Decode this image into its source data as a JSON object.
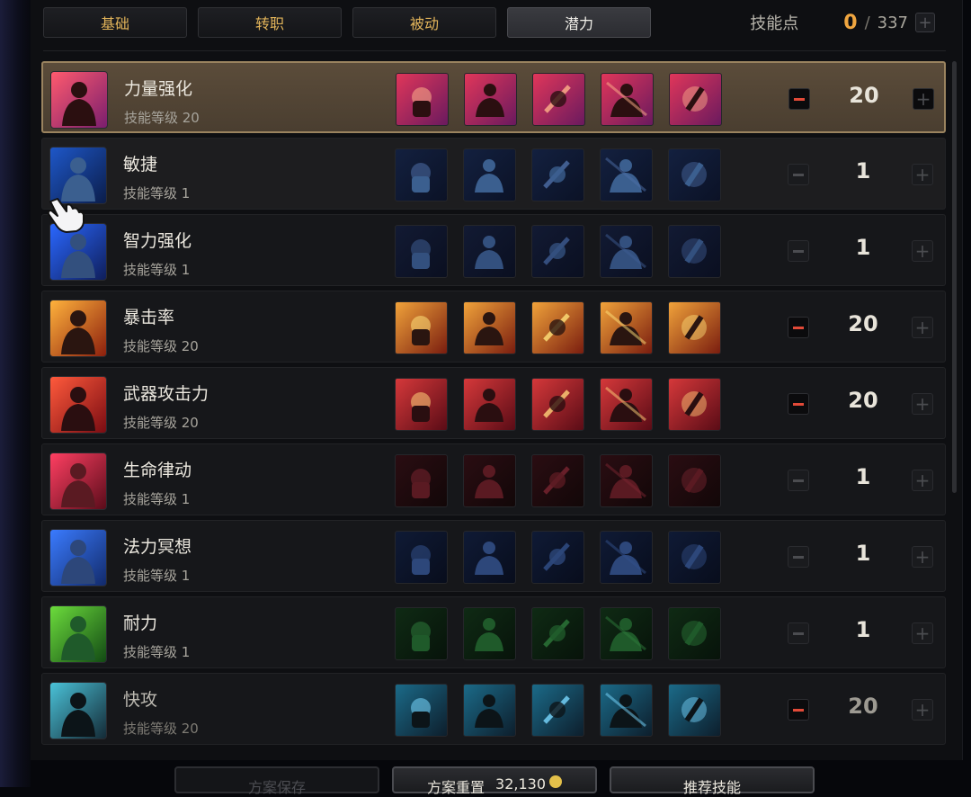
{
  "tabs": [
    {
      "label": "基础",
      "active": false
    },
    {
      "label": "转职",
      "active": false
    },
    {
      "label": "被动",
      "active": false
    },
    {
      "label": "潜力",
      "active": true
    }
  ],
  "points": {
    "label": "技能点",
    "current": "0",
    "separator": "/",
    "max": "337"
  },
  "skills": [
    {
      "name": "力量强化",
      "level": "技能等级 20",
      "value": "20",
      "icon": "fist-power-icon",
      "theme": "red-purple",
      "state": "selected"
    },
    {
      "name": "敏捷",
      "level": "技能等级 1",
      "value": "1",
      "icon": "agility-runner-icon",
      "theme": "dark-blue",
      "state": "hover"
    },
    {
      "name": "智力强化",
      "level": "技能等级 1",
      "value": "1",
      "icon": "intellect-head-icon",
      "theme": "dark-navy",
      "state": "normal"
    },
    {
      "name": "暴击率",
      "level": "技能等级 20",
      "value": "20",
      "icon": "critical-punch-icon",
      "theme": "orange",
      "state": "normal"
    },
    {
      "name": "武器攻击力",
      "level": "技能等级 20",
      "value": "20",
      "icon": "weapon-attack-icon",
      "theme": "crimson",
      "state": "normal"
    },
    {
      "name": "生命律动",
      "level": "技能等级 1",
      "value": "1",
      "icon": "life-pulse-icon",
      "theme": "dark-red",
      "state": "normal"
    },
    {
      "name": "法力冥想",
      "level": "技能等级 1",
      "value": "1",
      "icon": "mana-meditation-icon",
      "theme": "dark-blue2",
      "state": "normal"
    },
    {
      "name": "耐力",
      "level": "技能等级 1",
      "value": "1",
      "icon": "stamina-body-icon",
      "theme": "dark-green",
      "state": "normal"
    },
    {
      "name": "快攻",
      "level": "技能等级 20",
      "value": "20",
      "icon": "quick-attack-icon",
      "theme": "teal",
      "state": "dim"
    }
  ],
  "bottom": {
    "save": "方案保存",
    "reset": "方案重置",
    "reset_cost": "32,130",
    "recommend": "推荐技能"
  },
  "colors": {
    "accent": "#f0a640",
    "minus_active": "#e24a38",
    "selected_border": "#9a835f"
  }
}
